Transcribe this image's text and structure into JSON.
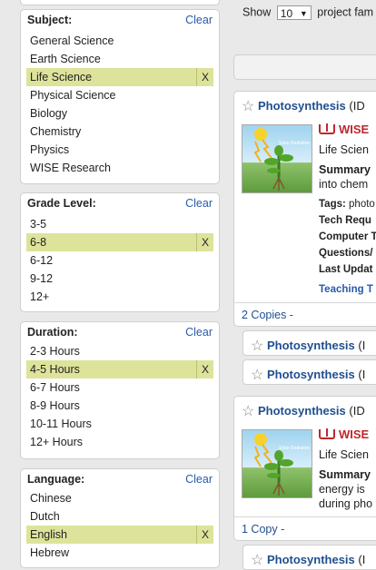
{
  "filters": {
    "subject": {
      "title": "Subject:",
      "clear": "Clear",
      "options": [
        "General Science",
        "Earth Science",
        "Life Science",
        "Physical Science",
        "Biology",
        "Chemistry",
        "Physics",
        "WISE Research"
      ],
      "selected": "Life Science"
    },
    "grade": {
      "title": "Grade Level:",
      "clear": "Clear",
      "options": [
        "3-5",
        "6-8",
        "6-12",
        "9-12",
        "12+"
      ],
      "selected": "6-8"
    },
    "duration": {
      "title": "Duration:",
      "clear": "Clear",
      "options": [
        "2-3 Hours",
        "4-5 Hours",
        "6-7 Hours",
        "8-9 Hours",
        "10-11 Hours",
        "12+ Hours"
      ],
      "selected": "4-5 Hours"
    },
    "language": {
      "title": "Language:",
      "clear": "Clear",
      "options": [
        "Chinese",
        "Dutch",
        "English",
        "Hebrew"
      ],
      "selected": "English"
    },
    "remove_symbol": "X"
  },
  "results": {
    "show_label": "Show",
    "per_page_value": "10",
    "per_page_suffix": "project fam",
    "cards": [
      {
        "title": "Photosynthesis",
        "id_prefix": "(ID",
        "source": "WISE",
        "subject": "Life Scien",
        "summary_label": "Summary",
        "summary_line1": "",
        "summary_line2": "into chem",
        "summary_line3": "",
        "tags_label": "Tags:",
        "tags_value": "photo",
        "tech_label": "Tech Requ",
        "computer_label": "Computer T",
        "questions_label": "Questions/",
        "updated_label": "Last Updat",
        "teaching_label": "Teaching T",
        "copies": "2 Copies -",
        "thumb_caption": "Solar Radiation"
      },
      {
        "title": "Photosynthesis",
        "id_prefix": "(ID",
        "source": "WISE",
        "subject": "Life Scien",
        "summary_label": "Summary",
        "summary_line2": "energy is",
        "summary_line3": "during pho",
        "copies": "1 Copy -",
        "thumb_caption": "Solar Radiation"
      }
    ],
    "copy_rows": [
      {
        "title": "Photosynthesis",
        "id_prefix": "(I"
      },
      {
        "title": "Photosynthesis",
        "id_prefix": "(I"
      },
      {
        "title": "Photosynthesis",
        "id_prefix": "(I"
      }
    ]
  }
}
